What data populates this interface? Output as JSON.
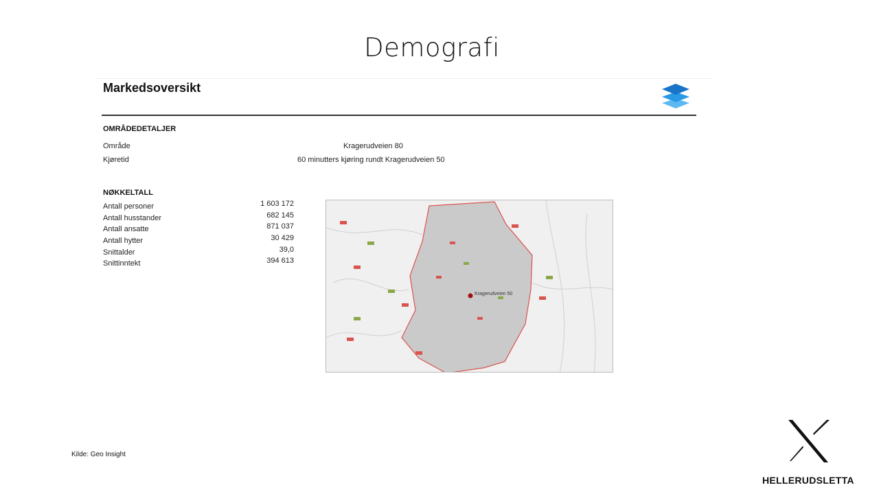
{
  "slide": {
    "title": "Demografi",
    "source": "Kilde: Geo Insight"
  },
  "report": {
    "heading": "Markedsoversikt",
    "layers_icon": "layers-icon",
    "accent": "#1e90e0",
    "area_details": {
      "label": "OMRÅDEDETALJER",
      "rows": [
        {
          "label": "Område",
          "value": "Kragerudveien 80"
        },
        {
          "label": "Kjøretid",
          "value": "60 minutters kjøring rundt Kragerudveien 50"
        }
      ]
    },
    "key_figures": {
      "label": "NØKKELTALL",
      "rows": [
        {
          "label": "Antall personer",
          "value": "1 603 172"
        },
        {
          "label": "Antall husstander",
          "value": "682 145"
        },
        {
          "label": "Antall ansatte",
          "value": "871 037"
        },
        {
          "label": "Antall hytter",
          "value": "30 429"
        },
        {
          "label": "Snittalder",
          "value": "39,0"
        },
        {
          "label": "Snittinntekt",
          "value": "394 613"
        }
      ]
    },
    "map": {
      "marker_label": "Kragerudveien 50",
      "region_color": "#d9534f"
    }
  },
  "brand": {
    "name": "HELLERUDSLETTA"
  }
}
